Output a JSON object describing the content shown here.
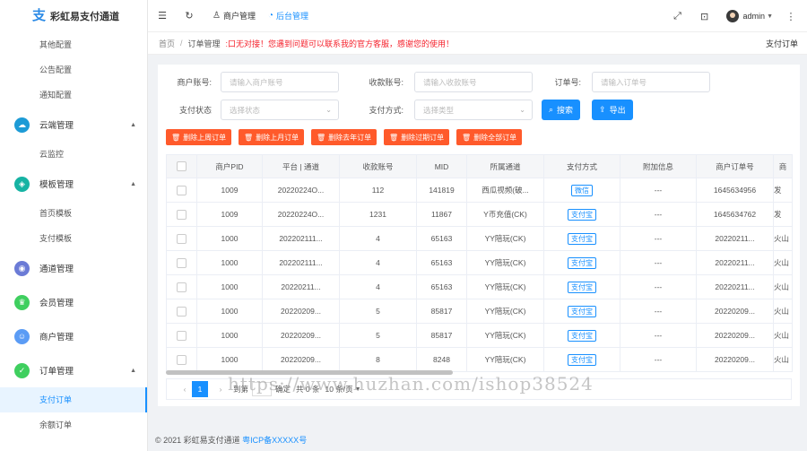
{
  "app": {
    "name": "彩虹易支付通道"
  },
  "colors": {
    "accent": "#1890ff",
    "danger": "#ff5a2b",
    "notice": "#f5222d"
  },
  "sidebar": {
    "top_subitems": [
      "其他配置",
      "公告配置",
      "通知配置"
    ],
    "groups": [
      {
        "label": "云端管理",
        "icon": "cloud-icon",
        "color": "#1d9bd6",
        "subitems": [
          "云监控"
        ],
        "expanded": true
      },
      {
        "label": "模板管理",
        "icon": "template-icon",
        "color": "#16b3a3",
        "subitems": [
          "首页模板",
          "支付模板"
        ],
        "expanded": true
      },
      {
        "label": "通道管理",
        "icon": "channel-icon",
        "color": "#6b7bd6",
        "subitems": [],
        "expanded": false
      },
      {
        "label": "会员管理",
        "icon": "member-icon",
        "color": "#3fcf5f",
        "subitems": [],
        "expanded": false
      },
      {
        "label": "商户管理",
        "icon": "merchant-icon",
        "color": "#5b9cf5",
        "subitems": [],
        "expanded": false
      },
      {
        "label": "订单管理",
        "icon": "order-icon",
        "color": "#3fcf5f",
        "subitems": [
          "支付订单",
          "余额订单"
        ],
        "expanded": true
      }
    ],
    "active_item": "支付订单"
  },
  "topbar": {
    "tabs": [
      {
        "label": "商户管理",
        "icon": "user-icon"
      },
      {
        "label": "后台管理",
        "icon": "dashboard-icon"
      }
    ],
    "user": "admin"
  },
  "breadcrumb": {
    "home": "首页",
    "current": "订单管理",
    "notice": ":口无对接！您遇到问题可以联系我的官方客服，感谢您的使用！",
    "right": "支付订单"
  },
  "filters": {
    "merchant_label": "商户账号:",
    "merchant_placeholder": "请输入商户账号",
    "collect_label": "收款账号:",
    "collect_placeholder": "请输入收款账号",
    "order_label": "订单号:",
    "order_placeholder": "请输入订单号",
    "status_label": "支付状态",
    "status_placeholder": "选择状态",
    "method_label": "支付方式:",
    "method_placeholder": "选择类型",
    "search_label": "搜索",
    "export_label": "导出"
  },
  "bulk_actions": [
    "删除上周订单",
    "删除上月订单",
    "删除去年订单",
    "删除过期订单",
    "删除全部订单"
  ],
  "table": {
    "columns": [
      "商户PID",
      "平台 | 通道",
      "收款账号",
      "MID",
      "所属通道",
      "支付方式",
      "附加信息",
      "商户订单号",
      "商"
    ],
    "rows": [
      [
        "1009",
        "20220224O...",
        "112",
        "141819",
        "西瓜视频(破...",
        "微信",
        "---",
        "1645634956",
        "发"
      ],
      [
        "1009",
        "20220224O...",
        "1231",
        "11867",
        "Y币充值(CK)",
        "支付宝",
        "---",
        "1645634762",
        "发"
      ],
      [
        "1000",
        "202202111...",
        "4",
        "65163",
        "YY陪玩(CK)",
        "支付宝",
        "---",
        "20220211...",
        "火山"
      ],
      [
        "1000",
        "202202111...",
        "4",
        "65163",
        "YY陪玩(CK)",
        "支付宝",
        "---",
        "20220211...",
        "火山"
      ],
      [
        "1000",
        "20220211...",
        "4",
        "65163",
        "YY陪玩(CK)",
        "支付宝",
        "---",
        "20220211...",
        "火山"
      ],
      [
        "1000",
        "20220209...",
        "5",
        "85817",
        "YY陪玩(CK)",
        "支付宝",
        "---",
        "20220209...",
        "火山"
      ],
      [
        "1000",
        "20220209...",
        "5",
        "85817",
        "YY陪玩(CK)",
        "支付宝",
        "---",
        "20220209...",
        "火山"
      ],
      [
        "1000",
        "20220209...",
        "8",
        "8248",
        "YY陪玩(CK)",
        "支付宝",
        "---",
        "20220209...",
        "火山"
      ]
    ]
  },
  "pager": {
    "current": "1",
    "goto": "到第",
    "confirm": "确定",
    "total": "共 0 条",
    "page_size": "10 条/页"
  },
  "footer": {
    "copyright": "© 2021 彩虹易支付通道",
    "icp": "粤ICP备XXXXX号"
  },
  "watermark": "https://www.huzhan.com/ishop38524"
}
